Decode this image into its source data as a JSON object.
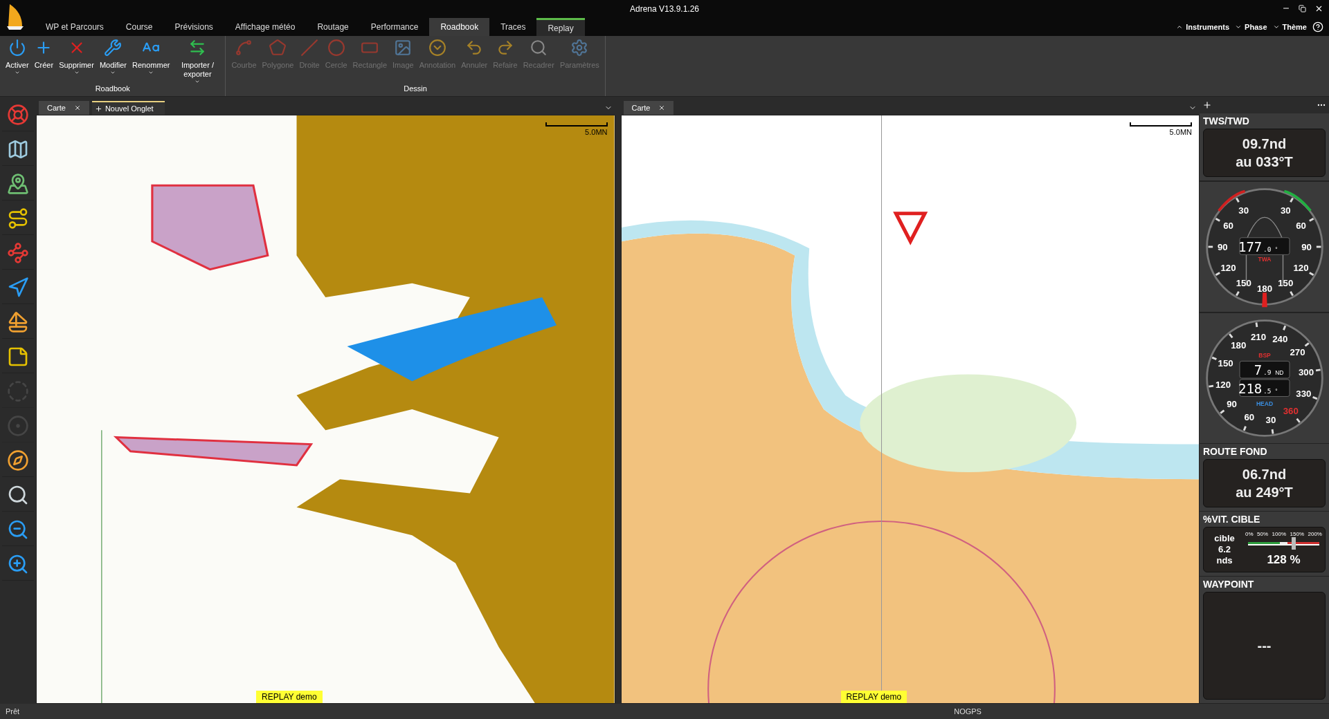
{
  "window": {
    "title": "Adrena V13.9.1.26"
  },
  "ribbon_tabs": [
    {
      "label": "WP et Parcours",
      "selected": false,
      "contextual": false
    },
    {
      "label": "Course",
      "selected": false,
      "contextual": false
    },
    {
      "label": "Prévisions",
      "selected": false,
      "contextual": false
    },
    {
      "label": "Affichage météo",
      "selected": false,
      "contextual": false
    },
    {
      "label": "Routage",
      "selected": false,
      "contextual": false
    },
    {
      "label": "Performance",
      "selected": false,
      "contextual": false
    },
    {
      "label": "Roadbook",
      "selected": true,
      "contextual": false
    },
    {
      "label": "Traces",
      "selected": false,
      "contextual": false
    },
    {
      "label": "Replay",
      "selected": false,
      "contextual": true
    }
  ],
  "top_menu": [
    {
      "label": "Instruments",
      "expanded": true
    },
    {
      "label": "Phase",
      "expanded": false
    },
    {
      "label": "Thème",
      "expanded": false
    }
  ],
  "ribbon_groups": [
    {
      "label": "Roadbook",
      "buttons": [
        {
          "label": "Activer",
          "disabled": false,
          "dropdown": true
        },
        {
          "label": "Créer",
          "disabled": false,
          "dropdown": false
        },
        {
          "label": "Supprimer",
          "disabled": false,
          "dropdown": true
        },
        {
          "label": "Modifier",
          "disabled": false,
          "dropdown": true
        },
        {
          "label": "Renommer",
          "disabled": false,
          "dropdown": true
        },
        {
          "label": "Importer / exporter",
          "disabled": false,
          "dropdown": true
        }
      ]
    },
    {
      "label": "Dessin",
      "buttons": [
        {
          "label": "Courbe",
          "disabled": true,
          "dropdown": false
        },
        {
          "label": "Polygone",
          "disabled": true,
          "dropdown": false
        },
        {
          "label": "Droite",
          "disabled": true,
          "dropdown": false
        },
        {
          "label": "Cercle",
          "disabled": true,
          "dropdown": false
        },
        {
          "label": "Rectangle",
          "disabled": true,
          "dropdown": false
        },
        {
          "label": "Image",
          "disabled": true,
          "dropdown": false
        },
        {
          "label": "Annotation",
          "disabled": true,
          "dropdown": false
        },
        {
          "label": "Annuler",
          "disabled": true,
          "dropdown": false
        },
        {
          "label": "Refaire",
          "disabled": true,
          "dropdown": false
        },
        {
          "label": "Recadrer",
          "disabled": true,
          "dropdown": false
        },
        {
          "label": "Paramètres",
          "disabled": true,
          "dropdown": false
        }
      ]
    }
  ],
  "left_toolbar": [
    {
      "disabled": false
    },
    {
      "disabled": false
    },
    {
      "disabled": false
    },
    {
      "disabled": false
    },
    {
      "disabled": false
    },
    {
      "disabled": false
    },
    {
      "disabled": false
    },
    {
      "disabled": false
    },
    {
      "disabled": true
    },
    {
      "disabled": true
    },
    {
      "disabled": false
    },
    {
      "disabled": false
    },
    {
      "disabled": false
    },
    {
      "disabled": false
    }
  ],
  "panes": [
    {
      "tabs": [
        {
          "label": "Carte",
          "selected": true,
          "kind": "tab"
        },
        {
          "label": "Nouvel Onglet",
          "selected": false,
          "kind": "new"
        }
      ],
      "scale": "5.0MN",
      "overlay": "REPLAY demo"
    },
    {
      "tabs": [
        {
          "label": "Carte",
          "selected": true,
          "kind": "tab"
        }
      ],
      "scale": "5.0MN",
      "overlay": "REPLAY demo"
    }
  ],
  "instruments": [
    {
      "kind": "text",
      "title": "TWS/TWD",
      "lines": [
        "09.7nd",
        "au 033°T"
      ]
    },
    {
      "kind": "twa_dial",
      "left_scale": [
        "30",
        "60",
        "90",
        "120",
        "150"
      ],
      "right_scale": [
        "30",
        "60",
        "90",
        "120",
        "150"
      ],
      "bottom_label": "180",
      "readings": [
        {
          "value": "177",
          "decimal": ".0",
          "unit": "°",
          "label": "TWA"
        }
      ]
    },
    {
      "kind": "heading_dial",
      "scale": [
        {
          "text": "210",
          "color": "#ffffff"
        },
        {
          "text": "240",
          "color": "#ffffff"
        },
        {
          "text": "270",
          "color": "#ffffff"
        },
        {
          "text": "300",
          "color": "#ffffff"
        },
        {
          "text": "330",
          "color": "#ffffff"
        },
        {
          "text": "360",
          "color": "#e03030"
        },
        {
          "text": "30",
          "color": "#ffffff"
        },
        {
          "text": "60",
          "color": "#ffffff"
        },
        {
          "text": "90",
          "color": "#ffffff"
        },
        {
          "text": "120",
          "color": "#ffffff"
        },
        {
          "text": "150",
          "color": "#ffffff"
        },
        {
          "text": "180",
          "color": "#ffffff"
        }
      ],
      "readings": [
        {
          "value": "7",
          "decimal": ".9",
          "unit": "ND",
          "label": "BSP"
        },
        {
          "value": "218",
          "decimal": ".5",
          "unit": "°",
          "label": "HEAD"
        }
      ]
    },
    {
      "kind": "text",
      "title": "ROUTE FOND",
      "lines": [
        "06.7nd",
        "au 249°T"
      ]
    },
    {
      "kind": "target",
      "title": "%VIT. CIBLE",
      "target_lines": [
        "cible",
        "6.2",
        "nds"
      ],
      "scale": [
        "0%",
        "50%",
        "100%",
        "150%",
        "200%"
      ],
      "level": 0.64,
      "reading": "128 %"
    },
    {
      "kind": "panel",
      "title": "WAYPOINT",
      "lines": [
        "---"
      ]
    }
  ],
  "status_bar": {
    "left": "Prêt",
    "center": "NOGPS"
  }
}
